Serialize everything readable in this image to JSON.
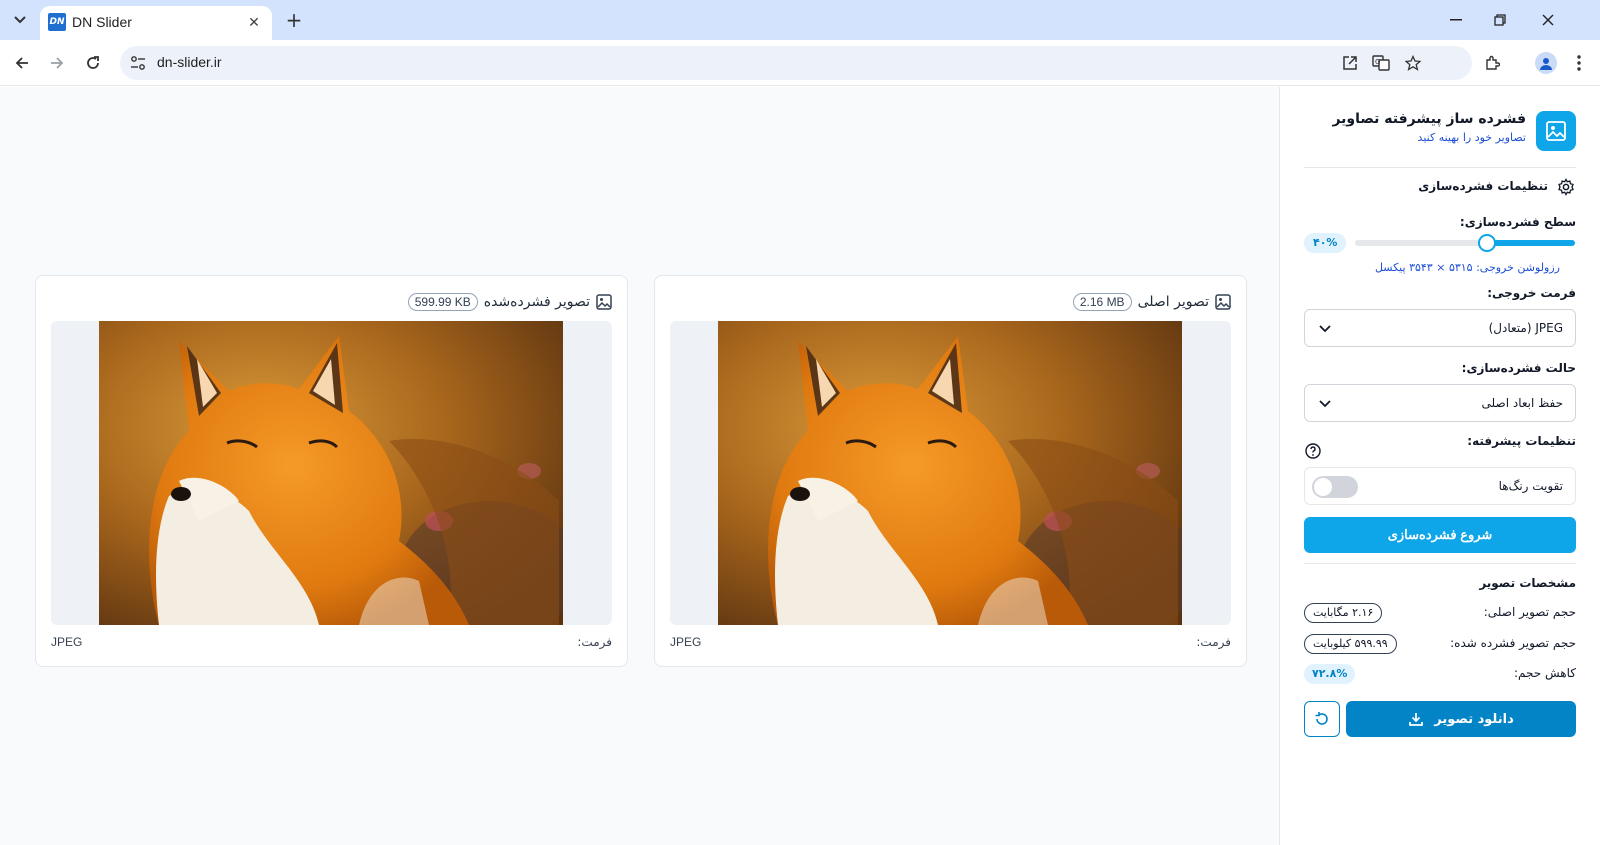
{
  "browser": {
    "tab_title": "DN Slider",
    "favicon_text": "DN",
    "url": "dn-slider.ir"
  },
  "cards": [
    {
      "title": "تصویر اصلی",
      "size": "2.16 MB",
      "format_label": "فرمت:",
      "format_value": "JPEG"
    },
    {
      "title": "تصویر فشرده‌شده",
      "size": "599.99 KB",
      "format_label": "فرمت:",
      "format_value": "JPEG"
    }
  ],
  "sidebar": {
    "app_title": "فشرده ساز پیشرفته تصاویر",
    "app_subtitle": "تصاویر خود را بهینه کنید",
    "settings_title": "تنظیمات فشرده‌سازی",
    "level_label": "سطح فشرده‌سازی:",
    "level_value_text": "۴۰%",
    "level_fraction": 0.4,
    "resolution_text": "رزولوشن خروجی: ۵۳۱۵ × ۳۵۴۳ پیکسل",
    "format_label": "فرمت خروجی:",
    "format_value": "JPEG (متعادل)",
    "mode_label": "حالت فشرده‌سازی:",
    "mode_value": "حفظ ابعاد اصلی",
    "advanced_label": "تنظیمات پیشرفته:",
    "color_boost_label": "تقویت رنگ‌ها",
    "color_boost_on": false,
    "start_button": "شروع فشرده‌سازی",
    "specs_title": "مشخصات تصویر",
    "original_size_label": "حجم تصویر اصلی:",
    "original_size_value": "۲.۱۶ مگابایت",
    "compressed_size_label": "حجم تصویر فشرده شده:",
    "compressed_size_value": "۵۹۹.۹۹ کیلوبایت",
    "reduction_label": "کاهش حجم:",
    "reduction_value": "۷۲.۸%",
    "download_button": "دانلود تصویر"
  },
  "colors": {
    "accent": "#0ea5e9",
    "accent_dark": "#0284c7",
    "tabstrip": "#d3e3fd"
  }
}
